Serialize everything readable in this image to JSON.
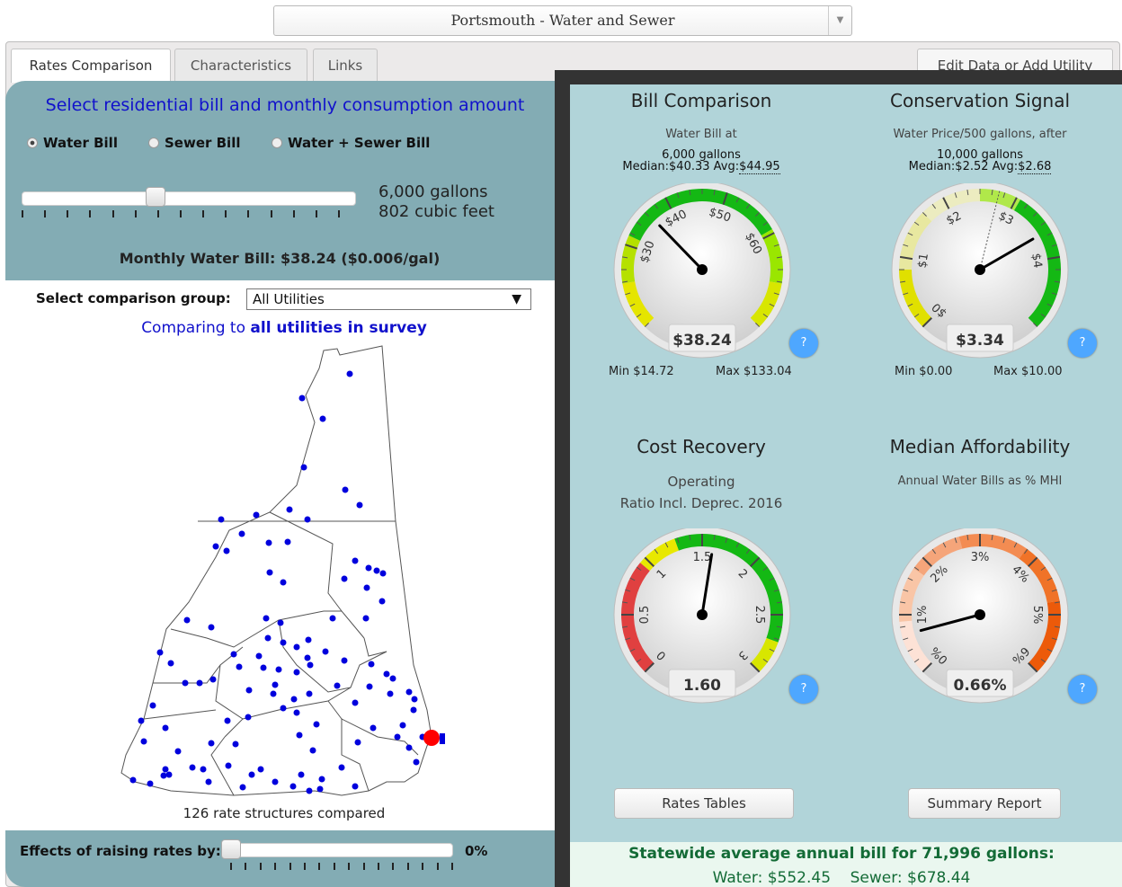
{
  "top_select": {
    "value": "Portsmouth - Water and Sewer"
  },
  "tabs": [
    "Rates Comparison",
    "Characteristics",
    "Links"
  ],
  "edit_button": "Edit Data or Add Utility",
  "left": {
    "title": "Select residential bill and monthly consumption amount",
    "radios": [
      {
        "label": "Water Bill",
        "checked": true
      },
      {
        "label": "Sewer Bill",
        "checked": false
      },
      {
        "label": "Water + Sewer Bill",
        "checked": false
      }
    ],
    "consumption": {
      "gallons": "6,000 gallons",
      "cubic_feet": "802 cubic feet",
      "slider_fraction": 0.4
    },
    "monthly_bill": "Monthly Water Bill: $38.24 ($0.006/gal)",
    "comparison_label": "Select comparison group:",
    "comparison_value": "All Utilities",
    "comparing_prefix": "Comparing to ",
    "comparing_bold": "all utilities in survey",
    "structures": "126 rate structures compared",
    "effects_label": "Effects of raising rates by:",
    "effects_value": "0%"
  },
  "gauges": [
    {
      "title": "Bill Comparison",
      "sub1": "Water Bill at",
      "sub2": "6,000 gallons",
      "median_label": "Median:$40.33",
      "avg_label": "Avg:",
      "avg_value": "$44.95",
      "value": "$38.24",
      "min": "Min $14.72",
      "max": "Max $133.04",
      "ticks": [
        "$30",
        "$40",
        "$50",
        "$60"
      ]
    },
    {
      "title": "Conservation Signal",
      "sub1": "Water Price/500 gallons, after",
      "sub2": "10,000 gallons",
      "median_label": "Median:$2.52",
      "avg_label": "Avg:",
      "avg_value": "$2.68",
      "value": "$3.34",
      "min": "Min $0.00",
      "max": "Max $10.00",
      "ticks": [
        "$0",
        "$1",
        "$2",
        "$3",
        "$4"
      ]
    },
    {
      "title": "Cost Recovery",
      "sub1": "Operating",
      "sub2": "Ratio Incl. Deprec. 2016",
      "value": "1.60",
      "ticks": [
        "0",
        "0.5",
        "1",
        "1.5",
        "2",
        "2.5",
        "3"
      ]
    },
    {
      "title": "Median Affordability",
      "sub1": "Annual Water Bills as % MHI",
      "value": "0.66%",
      "ticks": [
        "0%",
        "1%",
        "2%",
        "3%",
        "4%",
        "5%",
        "6%"
      ]
    }
  ],
  "help_label": "?",
  "buttons": {
    "rates_tables": "Rates Tables",
    "summary_report": "Summary Report"
  },
  "statewide": {
    "line1": "Statewide average annual bill for 71,996 gallons:",
    "line2": "Water: $552.45    Sewer: $678.44"
  },
  "colors": {
    "panel_teal": "#83acb4",
    "gauge_bg": "#b1d4d9",
    "help_blue": "#4ea7ff",
    "statewide_green": "#136b36"
  }
}
